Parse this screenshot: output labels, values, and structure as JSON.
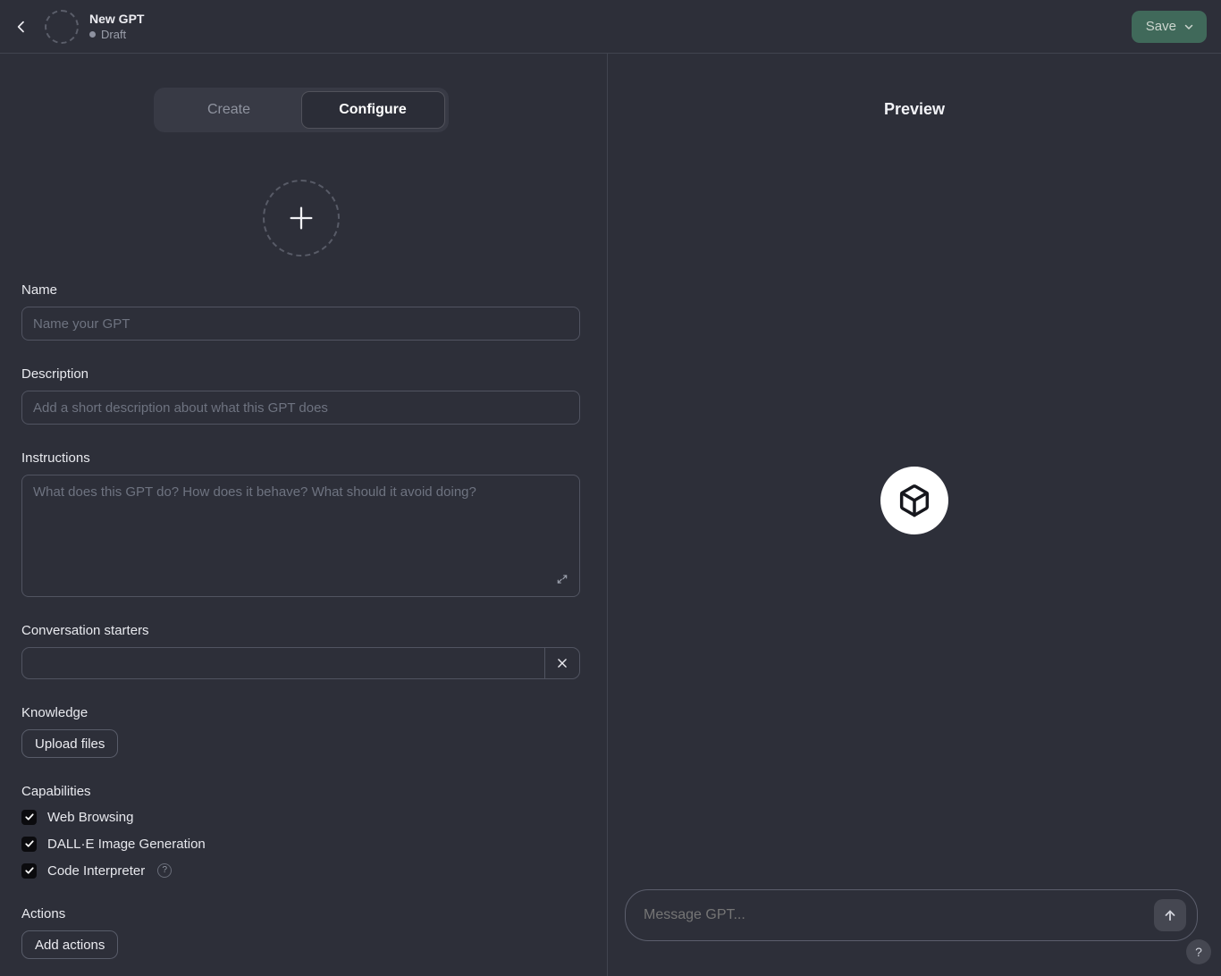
{
  "header": {
    "title": "New GPT",
    "status": "Draft",
    "save_label": "Save"
  },
  "tabs": [
    {
      "label": "Create",
      "active": false
    },
    {
      "label": "Configure",
      "active": true
    }
  ],
  "form": {
    "name": {
      "label": "Name",
      "placeholder": "Name your GPT",
      "value": ""
    },
    "description": {
      "label": "Description",
      "placeholder": "Add a short description about what this GPT does",
      "value": ""
    },
    "instructions": {
      "label": "Instructions",
      "placeholder": "What does this GPT do? How does it behave? What should it avoid doing?",
      "value": ""
    },
    "conversation_starters": {
      "label": "Conversation starters",
      "value": ""
    },
    "knowledge": {
      "label": "Knowledge",
      "upload_button": "Upload files"
    },
    "capabilities": {
      "label": "Capabilities",
      "items": [
        {
          "label": "Web Browsing",
          "checked": true
        },
        {
          "label": "DALL·E Image Generation",
          "checked": true
        },
        {
          "label": "Code Interpreter",
          "checked": true,
          "has_help": true
        }
      ]
    },
    "actions": {
      "label": "Actions",
      "add_button": "Add actions"
    }
  },
  "preview": {
    "title": "Preview",
    "message_placeholder": "Message GPT...",
    "help_icon": "?"
  },
  "icons": {
    "back": "chevron-left",
    "save_caret": "chevron-down",
    "avatar_add": "plus",
    "expand": "expand-diagonal",
    "starter_remove": "close",
    "gpt_avatar": "cube",
    "send": "arrow-up",
    "capability_help": "?"
  },
  "colors": {
    "background": "#2d2f39",
    "save_button": "#40695a",
    "checkbox": "#0b0b0e",
    "preview_avatar_bg": "#ffffff"
  }
}
